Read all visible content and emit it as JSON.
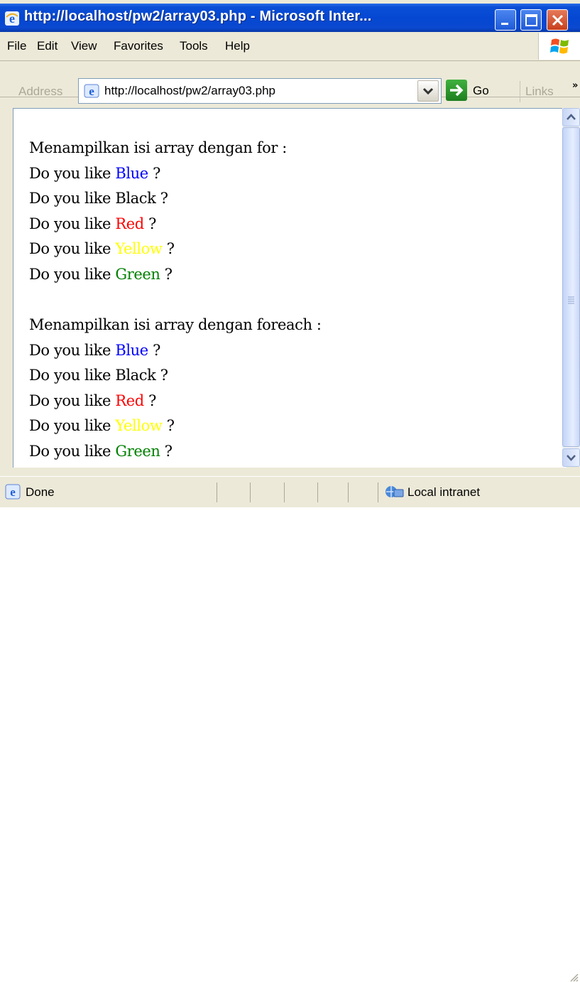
{
  "window": {
    "title": "http://localhost/pw2/array03.php - Microsoft Inter..."
  },
  "menu": {
    "items": [
      "File",
      "Edit",
      "View",
      "Favorites",
      "Tools",
      "Help"
    ]
  },
  "address": {
    "label": "Address",
    "url": "http://localhost/pw2/array03.php",
    "go_label": "Go",
    "links_label": "Links"
  },
  "page": {
    "heading_for": "Menampilkan isi array dengan for :",
    "heading_foreach": "Menampilkan isi array dengan foreach :",
    "prefix": "Do you like ",
    "suffix": " ?",
    "colors": [
      {
        "name": "Blue",
        "color": "#0000ff"
      },
      {
        "name": "Black",
        "color": "#000000"
      },
      {
        "name": "Red",
        "color": "#ff0000"
      },
      {
        "name": "Yellow",
        "color": "#ffff00"
      },
      {
        "name": "Green",
        "color": "#008000"
      }
    ]
  },
  "status": {
    "text": "Done",
    "zone": "Local intranet"
  },
  "icons": {
    "title": "ie-icon",
    "minimize": "minimize-icon",
    "maximize": "maximize-icon",
    "close": "close-icon",
    "windows_flag": "windows-logo-icon",
    "dropdown": "chevron-down-icon",
    "go": "arrow-right-icon",
    "links_more": "double-chevron-right-icon",
    "scroll_up": "chevron-up-icon",
    "scroll_down": "chevron-down-icon",
    "zone": "intranet-icon"
  }
}
